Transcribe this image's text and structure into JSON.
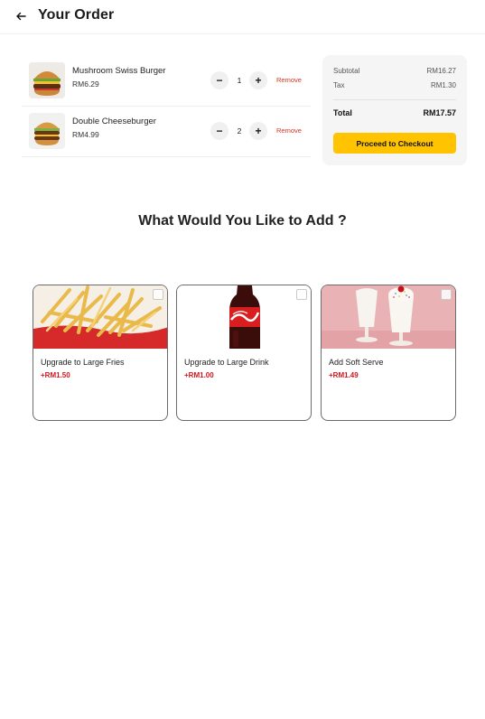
{
  "header": {
    "title": "Your Order",
    "back_icon": "arrow-left-icon"
  },
  "cart": {
    "items": [
      {
        "name": "Mushroom Swiss Burger",
        "price": "RM6.29",
        "qty": "1",
        "remove_label": "Remove",
        "minus": "−",
        "plus": "+"
      },
      {
        "name": "Double Cheeseburger",
        "price": "RM4.99",
        "qty": "2",
        "remove_label": "Remove",
        "minus": "−",
        "plus": "+"
      }
    ]
  },
  "summary": {
    "subtotal_label": "Subtotal",
    "subtotal_value": "RM16.27",
    "tax_label": "Tax",
    "tax_value": "RM1.30",
    "total_label": "Total",
    "total_value": "RM17.57",
    "checkout_label": "Proceed to Checkout"
  },
  "upsell": {
    "title": "What Would You Like to Add ?",
    "items": [
      {
        "name": "Upgrade to Large Fries",
        "price": "+RM1.50"
      },
      {
        "name": "Upgrade to Large Drink",
        "price": "+RM1.00"
      },
      {
        "name": "Add Soft Serve",
        "price": "+RM1.49"
      }
    ]
  },
  "colors": {
    "accent": "#ffc300",
    "remove": "#e0321f",
    "addon_price": "#d0161f"
  }
}
